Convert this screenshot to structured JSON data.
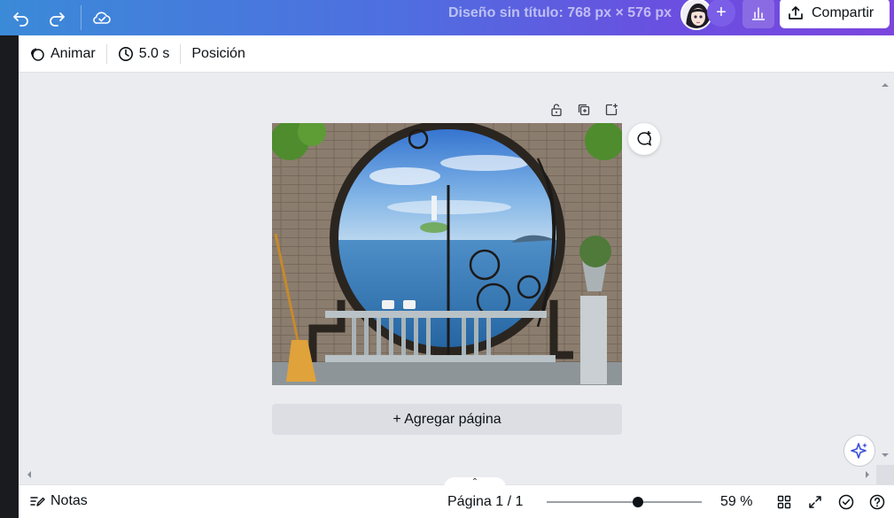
{
  "header": {
    "design_title": "Diseño sin título: 768 px × 576 px",
    "share_label": "Compartir",
    "icons": [
      "undo-icon",
      "redo-icon",
      "cloud-saved-icon",
      "plus-icon",
      "bar-chart-icon",
      "share-upload-icon"
    ]
  },
  "toolbar": {
    "animate_label": "Animar",
    "duration_label": "5.0 s",
    "position_label": "Posición"
  },
  "canvas": {
    "add_page_label": "+ Agregar página"
  },
  "status_bar": {
    "notes_label": "Notas",
    "page_indicator": "Página 1 / 1",
    "zoom_label": "59 %",
    "zoom_level": 0.59
  },
  "colors": {
    "header_gradient_start": "#3b8ad8",
    "header_gradient_end": "#7b45de",
    "canvas_bg": "#ebecf0",
    "left_strip": "#1a1b1e"
  }
}
